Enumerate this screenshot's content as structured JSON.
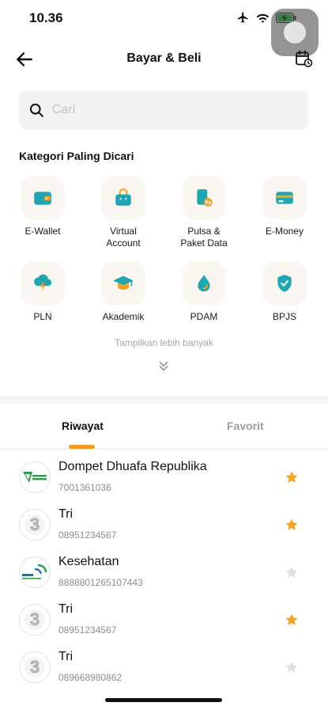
{
  "status_bar": {
    "time": "10.36"
  },
  "header": {
    "title": "Bayar & Beli"
  },
  "search": {
    "placeholder": "Cari"
  },
  "categories": {
    "title": "Kategori Paling Dicari",
    "items": [
      {
        "label": "E-Wallet",
        "icon": "wallet-icon"
      },
      {
        "label": "Virtual\nAccount",
        "icon": "shopping-bag-icon"
      },
      {
        "label": "Pulsa &\nPaket Data",
        "icon": "phone-credit-icon"
      },
      {
        "label": "E-Money",
        "icon": "card-icon"
      },
      {
        "label": "PLN",
        "icon": "electricity-icon"
      },
      {
        "label": "Akademik",
        "icon": "graduation-cap-icon"
      },
      {
        "label": "PDAM",
        "icon": "water-drop-icon"
      },
      {
        "label": "BPJS",
        "icon": "shield-check-icon"
      }
    ],
    "show_more": "Tampilkan lebih banyak"
  },
  "tabs": {
    "riwayat": "Riwayat",
    "favorit": "Favorit",
    "active": "Riwayat"
  },
  "history": [
    {
      "name": "Dompet Dhuafa Republika",
      "number": "7001361036",
      "favorite": true,
      "logo": "dompet-dhuafa-logo"
    },
    {
      "name": "Tri",
      "number": "08951234567",
      "favorite": true,
      "logo": "tri-logo"
    },
    {
      "name": "Kesehatan",
      "number": "8888801265107443",
      "favorite": false,
      "logo": "bpjs-logo"
    },
    {
      "name": "Tri",
      "number": "08951234567",
      "favorite": true,
      "logo": "tri-logo"
    },
    {
      "name": "Tri",
      "number": "089668980862",
      "favorite": false,
      "logo": "tri-logo"
    }
  ],
  "colors": {
    "accent": "#f29a1f",
    "icon_teal": "#1fa6b0",
    "icon_orange": "#f5a524",
    "star_inactive": "#e0e0e0"
  }
}
